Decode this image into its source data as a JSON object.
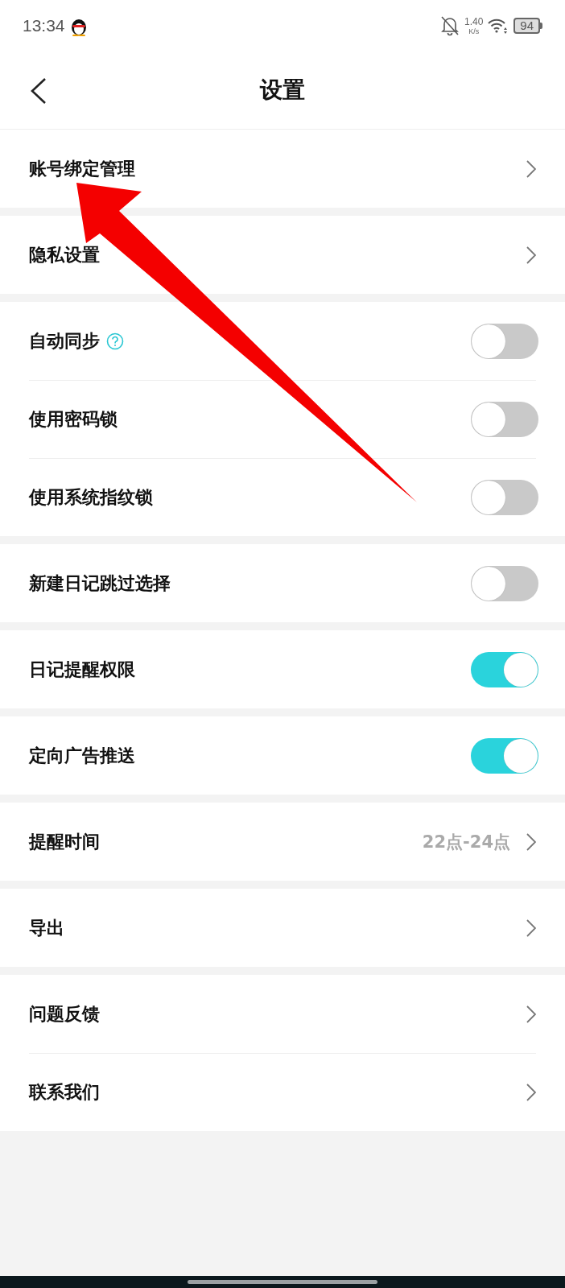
{
  "status_bar": {
    "time": "13:34",
    "speed": "1.40",
    "speed_unit": "K/s",
    "battery": "94"
  },
  "header": {
    "title": "设置"
  },
  "groups": [
    {
      "items": [
        {
          "kind": "link",
          "label": "账号绑定管理",
          "help": false
        }
      ]
    },
    {
      "items": [
        {
          "kind": "link",
          "label": "隐私设置",
          "help": false
        }
      ]
    },
    {
      "items": [
        {
          "kind": "toggle",
          "label": "自动同步",
          "help": true,
          "on": false
        },
        {
          "kind": "toggle",
          "label": "使用密码锁",
          "help": false,
          "on": false
        },
        {
          "kind": "toggle",
          "label": "使用系统指纹锁",
          "help": false,
          "on": false
        }
      ]
    },
    {
      "items": [
        {
          "kind": "toggle",
          "label": "新建日记跳过选择",
          "help": false,
          "on": false
        }
      ]
    },
    {
      "items": [
        {
          "kind": "toggle",
          "label": "日记提醒权限",
          "help": false,
          "on": true
        }
      ]
    },
    {
      "items": [
        {
          "kind": "toggle",
          "label": "定向广告推送",
          "help": false,
          "on": true
        }
      ]
    },
    {
      "items": [
        {
          "kind": "link",
          "label": "提醒时间",
          "help": false,
          "value": "22点-24点"
        }
      ]
    },
    {
      "items": [
        {
          "kind": "link",
          "label": "导出",
          "help": false
        }
      ]
    },
    {
      "items": [
        {
          "kind": "link",
          "label": "问题反馈",
          "help": false
        },
        {
          "kind": "link",
          "label": "联系我们",
          "help": false
        }
      ]
    }
  ],
  "overlay": {
    "kind": "arrow"
  }
}
